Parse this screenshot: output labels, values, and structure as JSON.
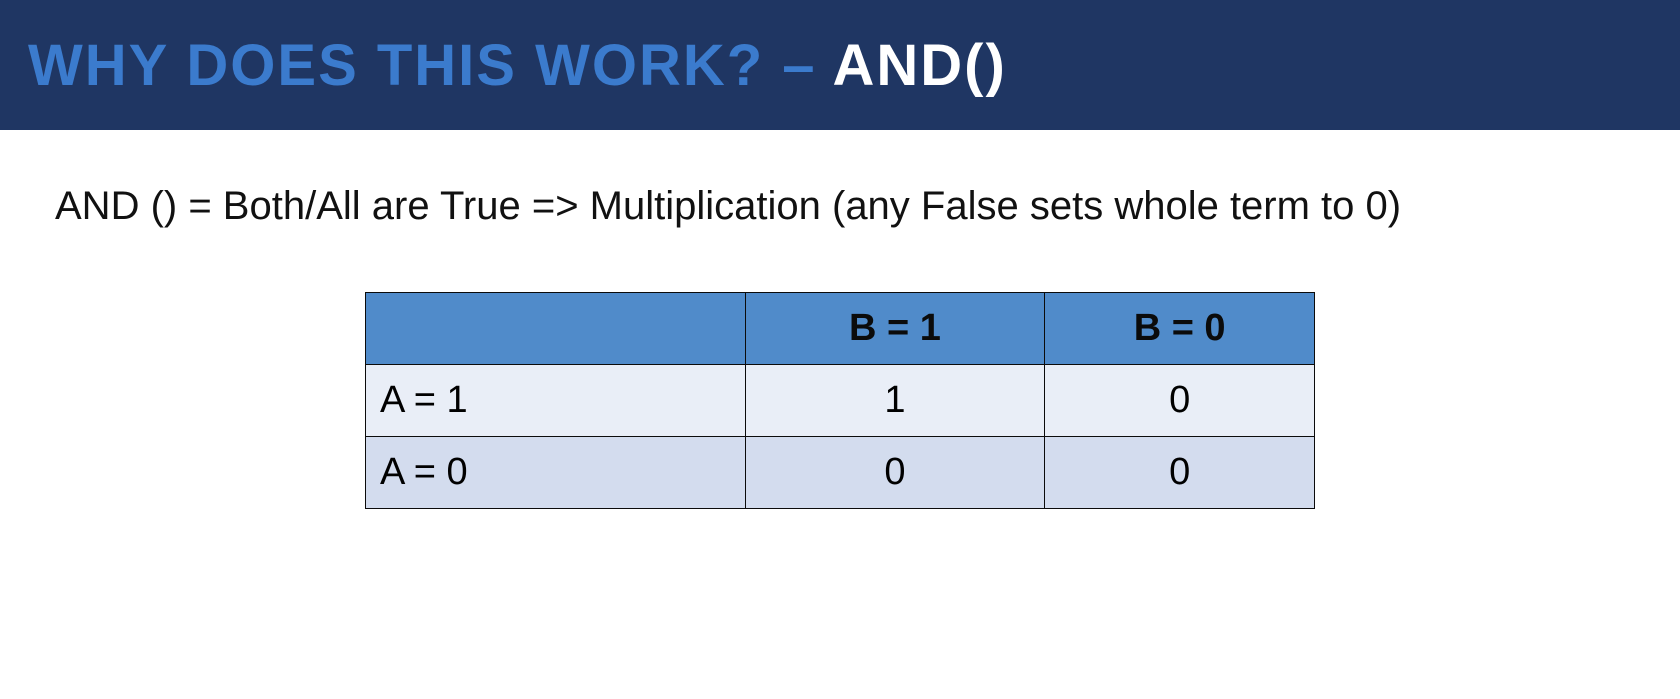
{
  "title": {
    "main": "WHY DOES THIS WORK? – ",
    "accent": "AND()"
  },
  "explanation": "AND () = Both/All are True => Multiplication (any False sets whole term to 0)",
  "table": {
    "col_headers": [
      "B = 1",
      "B = 0"
    ],
    "rows": [
      {
        "label": "A = 1",
        "values": [
          "1",
          "0"
        ]
      },
      {
        "label": "A = 0",
        "values": [
          "0",
          "0"
        ]
      }
    ]
  }
}
